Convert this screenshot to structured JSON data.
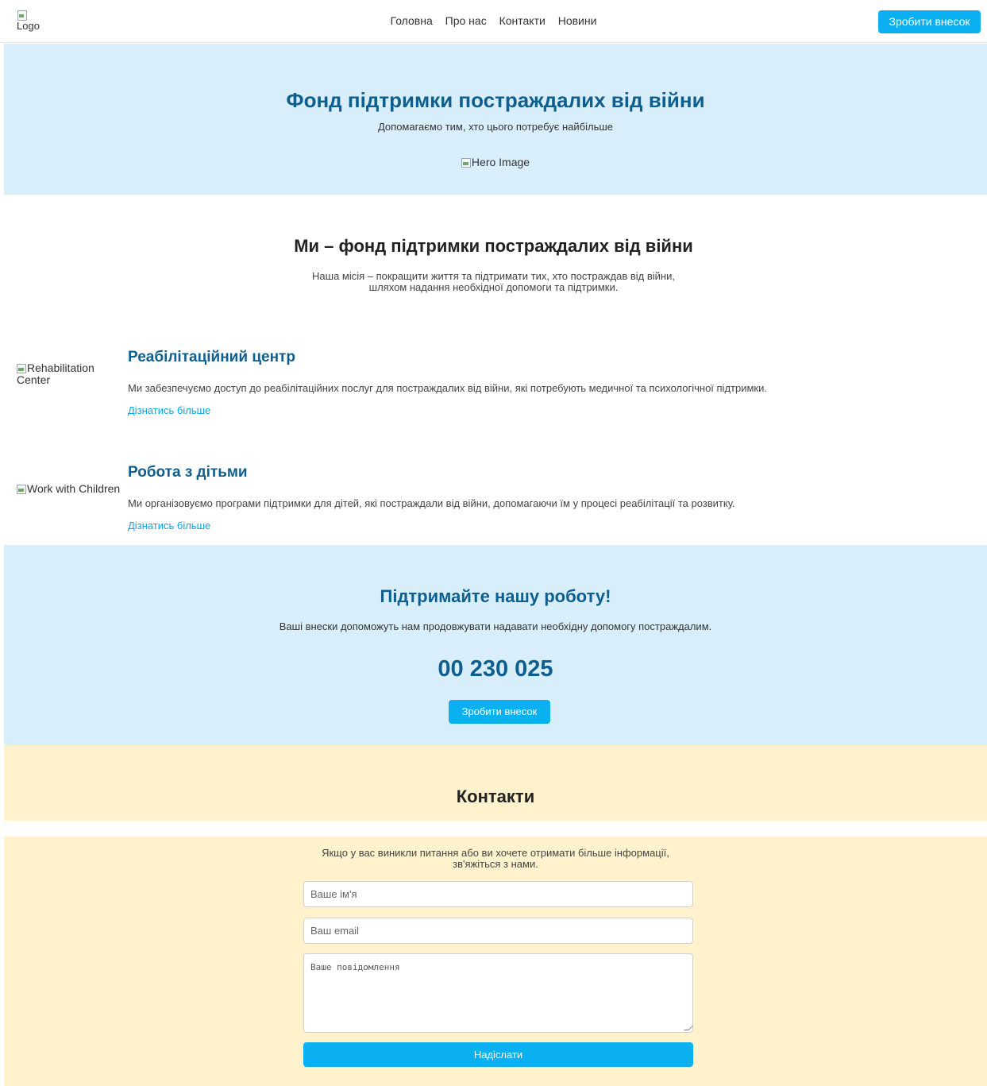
{
  "header": {
    "logo_alt": "Logo",
    "nav": [
      "Головна",
      "Про нас",
      "Контакти",
      "Новини"
    ],
    "donate_label": "Зробити внесок"
  },
  "hero": {
    "title": "Фонд підтримки постраждалих від війни",
    "subtitle": "Допомагаємо тим, хто цього потребує найбільше",
    "image_alt": "Hero Image"
  },
  "about": {
    "title": "Ми – фонд підтримки постраждалих від війни",
    "text_line1": "Наша місія – покращити життя та підтримати тих, хто постраждав від війни,",
    "text_line2": "шляхом надання необхідної допомоги та підтримки."
  },
  "services": [
    {
      "image_alt_line1": "Rehabilitation",
      "image_alt_line2": "Center",
      "title": "Реабілітаційний центр",
      "text": "Ми забезпечуємо доступ до реабілітаційних послуг для постраждалих від війни, які потребують медичної та психологічної підтримки.",
      "link": "Дізнатись більше"
    },
    {
      "image_alt_line1": "Work with Children",
      "title": "Робота з дітьми",
      "text": "Ми організовуємо програми підтримки для дітей, які постраждали від війни, допомагаючи їм у процесі реабілітації та розвитку.",
      "link": "Дізнатись більше"
    }
  ],
  "support": {
    "title": "Підтримайте нашу роботу!",
    "text": "Ваші внески допоможуть нам продовжувати надавати необхідну допомогу постраждалим.",
    "amount": "00 230 025",
    "button_label": "Зробити внесок"
  },
  "contacts": {
    "title": "Контакти",
    "intro_line1": "Якщо у вас виникли питання або ви хочете отримати більше інформації,",
    "intro_line2": "зв'яжіться з нами.",
    "name_placeholder": "Ваше ім'я",
    "email_placeholder": "Ваш email",
    "message_placeholder": "Ваше повідомлення",
    "submit_label": "Надіслати"
  },
  "colors": {
    "accent": "#0bb0f0",
    "heading_blue": "#0e5e8f",
    "light_blue_bg": "#d8eefb",
    "light_yellow_bg": "#fff2cc"
  }
}
